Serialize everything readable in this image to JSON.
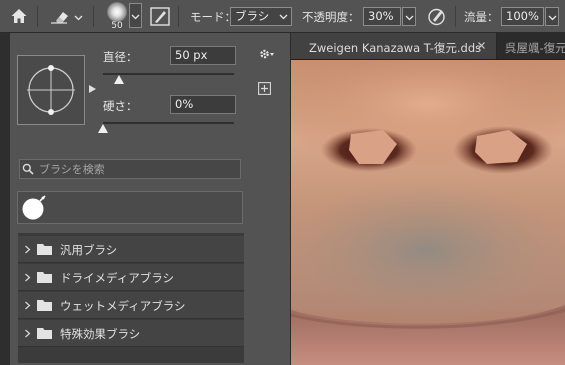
{
  "options_bar": {
    "home_icon": "home-icon",
    "tool_icon": "eraser-icon",
    "brush_size": "50",
    "mode_label": "モード：",
    "mode_value": "ブラシ",
    "opacity_label": "不透明度：",
    "opacity_value": "30%",
    "pressure_icon": "pen-pressure-icon",
    "flow_label": "流量：",
    "flow_value": "100%"
  },
  "brush_panel": {
    "diameter_label": "直径：",
    "diameter_value": "50 px",
    "diameter_level_fraction": 0.12,
    "hardness_label": "硬さ：",
    "hardness_value": "0%",
    "hardness_level_fraction": 0.0,
    "search_placeholder": "ブラシを検索",
    "folders": [
      "汎用ブラシ",
      "ドライメディアブラシ",
      "ウェットメディアブラシ",
      "特殊効果ブラシ"
    ]
  },
  "document_tabs": [
    {
      "title": "Zweigen Kanazawa T-復元.dds",
      "close": "×",
      "active": true
    },
    {
      "title": "呉屋颯-復元",
      "active": false
    }
  ],
  "colors": {
    "panel_bg": "#535353",
    "workspace_bg": "#323232",
    "field_bg": "#3c3c3c",
    "text": "#e3e3e3",
    "skin": "#d6a587"
  }
}
